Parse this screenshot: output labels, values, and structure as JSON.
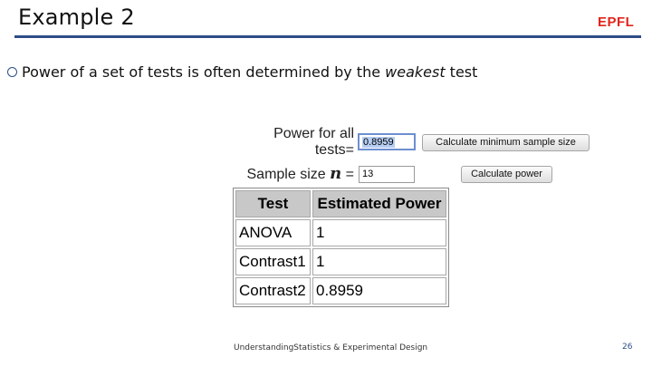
{
  "slide": {
    "title": "Example 2",
    "logo": "EPFL",
    "bullet_prefix": "Power of a set of tests is often determined by the ",
    "bullet_emphasis": "weakest",
    "bullet_suffix": " test"
  },
  "form": {
    "power_label_line1": "Power for all",
    "power_label_line2": "tests=",
    "power_value": "0.8959",
    "sample_size_label": "Sample size",
    "sample_size_var": "n",
    "equals": "=",
    "sample_size_value": "13",
    "calc_min_sample_button": "Calculate minimum sample size",
    "calc_power_button": "Calculate power"
  },
  "table": {
    "headers": [
      "Test",
      "Estimated Power"
    ],
    "rows": [
      [
        "ANOVA",
        "1"
      ],
      [
        "Contrast1",
        "1"
      ],
      [
        "Contrast2",
        "0.8959"
      ]
    ]
  },
  "footer": {
    "text": "UnderstandingStatistics & Experimental Design",
    "page_number": "26"
  }
}
